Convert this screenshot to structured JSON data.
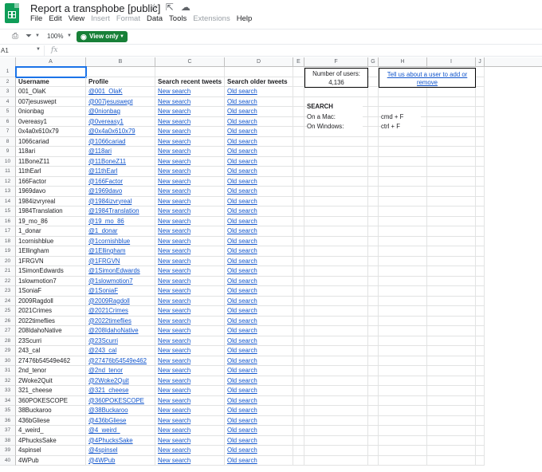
{
  "app": {
    "title": "Report a transphobe [public]",
    "menu": [
      "File",
      "Edit",
      "View",
      "Insert",
      "Format",
      "Data",
      "Tools",
      "Extensions",
      "Help"
    ],
    "menu_disabled": [
      "Insert",
      "Format",
      "Extensions"
    ]
  },
  "toolbar": {
    "zoom": "100%",
    "view_only_label": "View only"
  },
  "formula_bar": {
    "cell_ref": "A1",
    "fx_label": "fx"
  },
  "columns": [
    "A",
    "B",
    "C",
    "D",
    "E",
    "F",
    "G",
    "H",
    "I",
    "J"
  ],
  "headers": {
    "username": "Username",
    "profile": "Profile",
    "recent": "Search recent tweets",
    "older": "Search older tweets"
  },
  "info": {
    "users_label": "Number of users:",
    "users_count": "4,136",
    "tell_us": "Tell us about a user to add or remove",
    "search_title": "SEARCH",
    "mac_label": "On a Mac:",
    "mac_keys": "cmd + F",
    "windows_label": "On Windows:",
    "windows_keys": "ctrl + F"
  },
  "link_texts": {
    "new_search": "New search",
    "old_search": "Old search"
  },
  "rows": [
    {
      "n": "3",
      "user": "001_OlaK",
      "profile": "@001_OlaK"
    },
    {
      "n": "4",
      "user": "007jesuswept",
      "profile": "@007jesuswept"
    },
    {
      "n": "5",
      "user": "0nionbag",
      "profile": "@0nionbag"
    },
    {
      "n": "6",
      "user": "0vereasy1",
      "profile": "@0vereasy1"
    },
    {
      "n": "7",
      "user": "0x4a0x610x79",
      "profile": "@0x4a0x610x79"
    },
    {
      "n": "8",
      "user": "1066cariad",
      "profile": "@1066cariad"
    },
    {
      "n": "9",
      "user": "118ari",
      "profile": "@118ari"
    },
    {
      "n": "10",
      "user": "11BoneZ11",
      "profile": "@11BoneZ11"
    },
    {
      "n": "11",
      "user": "11thEarl",
      "profile": "@11thEarl"
    },
    {
      "n": "12",
      "user": "166Factor",
      "profile": "@166Factor"
    },
    {
      "n": "13",
      "user": "1969davo",
      "profile": "@1969davo"
    },
    {
      "n": "14",
      "user": "1984izvryreal",
      "profile": "@1984izvryreal"
    },
    {
      "n": "15",
      "user": "1984Translation",
      "profile": "@1984Translation"
    },
    {
      "n": "16",
      "user": "19_mo_86",
      "profile": "@19_mo_86"
    },
    {
      "n": "17",
      "user": "1_donar",
      "profile": "@1_donar"
    },
    {
      "n": "18",
      "user": "1cornishblue",
      "profile": "@1cornishblue"
    },
    {
      "n": "19",
      "user": "1Ellingham",
      "profile": "@1Ellingham"
    },
    {
      "n": "20",
      "user": "1FRGVN",
      "profile": "@1FRGVN"
    },
    {
      "n": "21",
      "user": "1SimonEdwards",
      "profile": "@1SimonEdwards"
    },
    {
      "n": "22",
      "user": "1slowmotion7",
      "profile": "@1slowmotion7"
    },
    {
      "n": "23",
      "user": "1SoniaF",
      "profile": "@1SoniaF"
    },
    {
      "n": "24",
      "user": "2009Ragdoll",
      "profile": "@2009Ragdoll"
    },
    {
      "n": "25",
      "user": "2021Crimes",
      "profile": "@2021Crimes"
    },
    {
      "n": "26",
      "user": "2022timeflies",
      "profile": "@2022timeflies"
    },
    {
      "n": "27",
      "user": "208IdahoNative",
      "profile": "@208IdahoNative"
    },
    {
      "n": "28",
      "user": "23Scurri",
      "profile": "@23Scurri"
    },
    {
      "n": "29",
      "user": "243_cal",
      "profile": "@243_cal"
    },
    {
      "n": "30",
      "user": "27476b54549e462",
      "profile": "@27476b54549e462"
    },
    {
      "n": "31",
      "user": "2nd_tenor",
      "profile": "@2nd_tenor"
    },
    {
      "n": "32",
      "user": "2Woke2Quit",
      "profile": "@2Woke2Quit"
    },
    {
      "n": "33",
      "user": "321_cheese",
      "profile": "@321_cheese"
    },
    {
      "n": "34",
      "user": "360POKESCOPE",
      "profile": "@360POKESCOPE"
    },
    {
      "n": "35",
      "user": "38Buckaroo",
      "profile": "@38Buckaroo"
    },
    {
      "n": "36",
      "user": "436bGliese",
      "profile": "@436bGliese"
    },
    {
      "n": "37",
      "user": "4_weird_",
      "profile": "@4_weird_"
    },
    {
      "n": "38",
      "user": "4PhucksSake",
      "profile": "@4PhucksSake"
    },
    {
      "n": "39",
      "user": "4spinsel",
      "profile": "@4spinsel"
    },
    {
      "n": "40",
      "user": "4WPub",
      "profile": "@4WPub"
    }
  ]
}
